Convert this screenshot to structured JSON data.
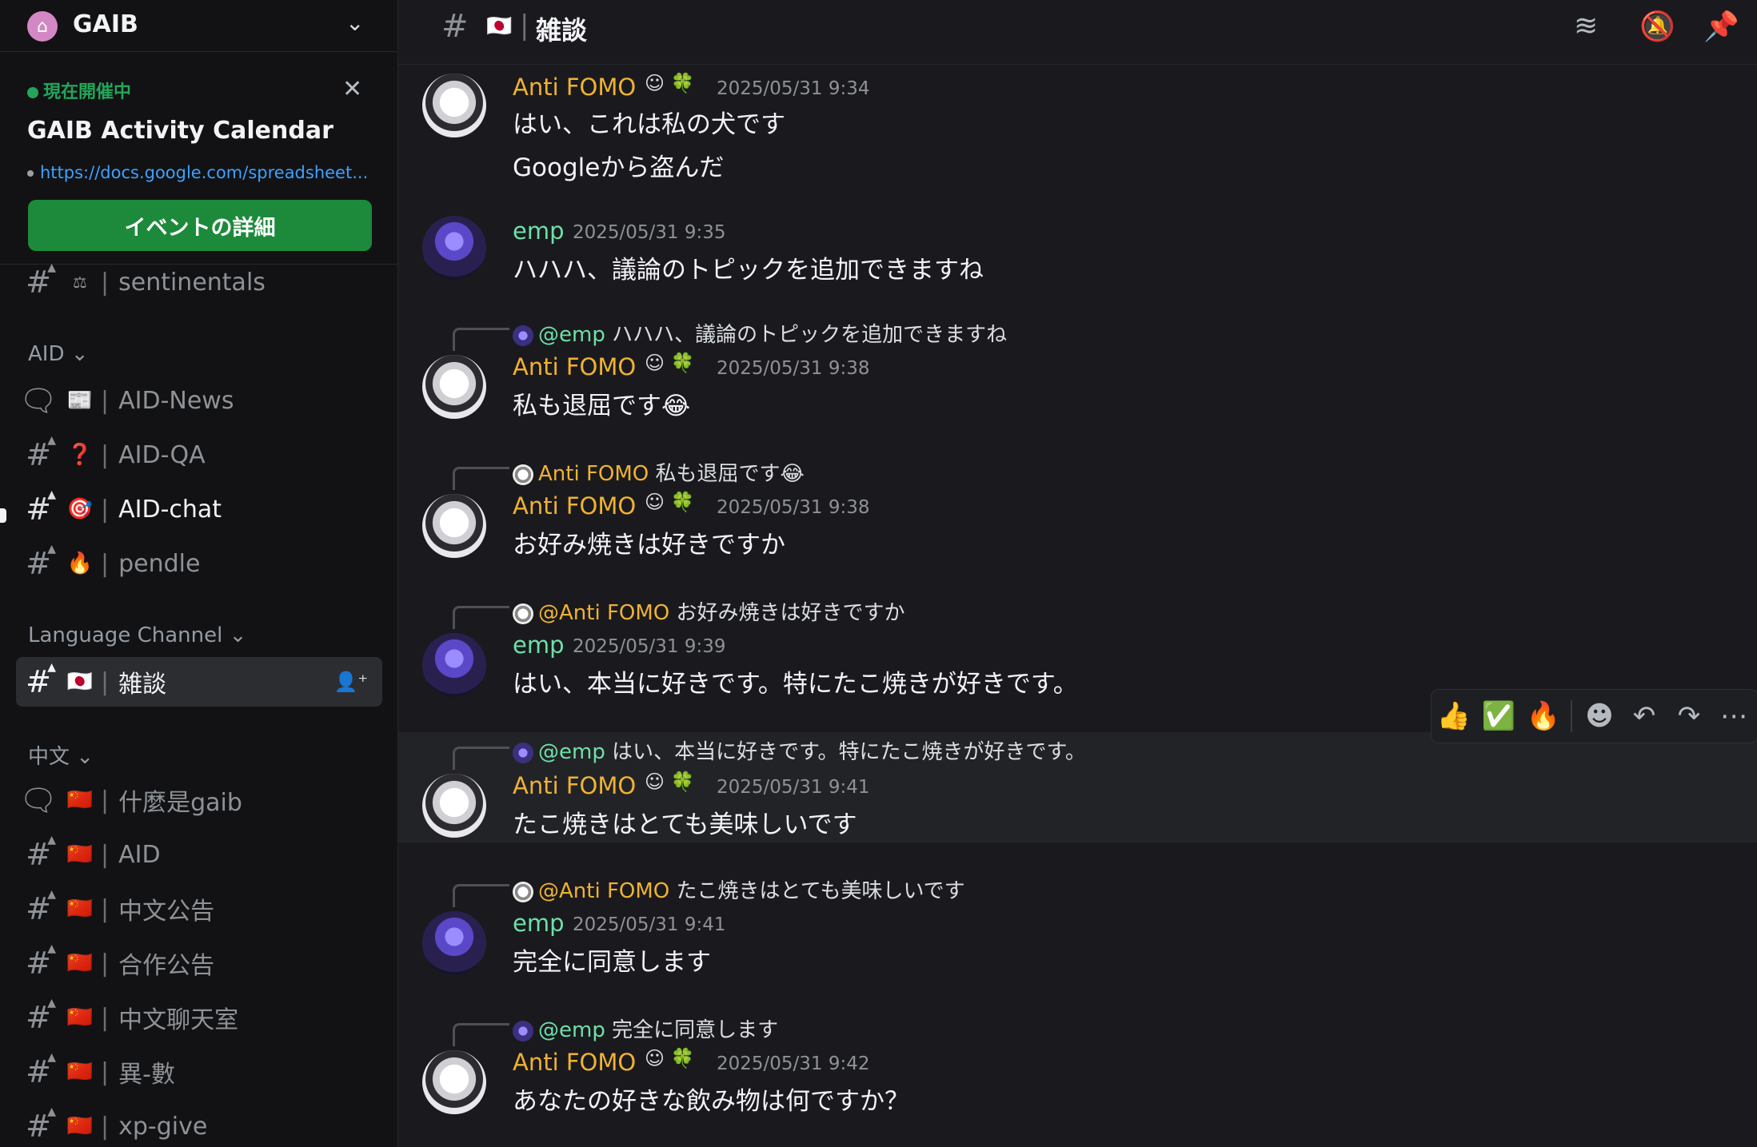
{
  "server": {
    "name": "GAIB",
    "icon": "home-icon"
  },
  "event": {
    "status": "現在開催中",
    "title": "GAIB Activity Calendar",
    "link": "https://docs.google.com/spreadsheet...",
    "button": "イベントの詳細"
  },
  "channels": {
    "top": {
      "emoji": "⚖",
      "name": "sentinentals"
    },
    "aid_category": "AID",
    "aid": [
      {
        "type": "forum",
        "emoji": "📰",
        "name": "AID-News"
      },
      {
        "type": "text",
        "emoji": "❓",
        "name": "AID-QA"
      },
      {
        "type": "text",
        "emoji": "🎯",
        "name": "AID-chat"
      },
      {
        "type": "text",
        "emoji": "🔥",
        "name": "pendle"
      }
    ],
    "lang_category": "Language Channel",
    "lang": [
      {
        "type": "text",
        "emoji": "🇯🇵",
        "name": "雑談"
      }
    ],
    "zh_category": "中文",
    "zh": [
      {
        "type": "forum",
        "emoji": "🇨🇳",
        "name": "什麼是gaib"
      },
      {
        "type": "text",
        "emoji": "🇨🇳",
        "name": "AID"
      },
      {
        "type": "text",
        "emoji": "🇨🇳",
        "name": "中文公告"
      },
      {
        "type": "text",
        "emoji": "🇨🇳",
        "name": "合作公告"
      },
      {
        "type": "text",
        "emoji": "🇨🇳",
        "name": "中文聊天室"
      },
      {
        "type": "text",
        "emoji": "🇨🇳",
        "name": "異-數"
      },
      {
        "type": "text",
        "emoji": "🇨🇳",
        "name": "xp-give"
      }
    ]
  },
  "header": {
    "flag": "🇯🇵",
    "sep": "|",
    "name": "雑談",
    "icons": [
      "threads-icon",
      "mute-icon",
      "pin-icon"
    ]
  },
  "messages": [
    {
      "author": "Anti FOMO",
      "time": "2025/05/31 9:34",
      "lines": [
        "はい、これは私の犬です",
        "Googleから盗んだ"
      ]
    },
    {
      "author": "emp",
      "time": "2025/05/31 9:35",
      "lines": [
        "ハハハ、議論のトピックを追加できますね"
      ]
    },
    {
      "reply_name": "@emp",
      "reply_text": "ハハハ、議論のトピックを追加できますね",
      "author": "Anti FOMO",
      "time": "2025/05/31 9:38",
      "lines": [
        "私も退屈です😂"
      ]
    },
    {
      "reply_name": "Anti FOMO",
      "reply_text": "私も退屈です😂",
      "author": "Anti FOMO",
      "time": "2025/05/31 9:38",
      "lines": [
        "お好み焼きは好きですか"
      ]
    },
    {
      "reply_name": "@Anti FOMO",
      "reply_text": "お好み焼きは好きですか",
      "author": "emp",
      "time": "2025/05/31 9:39",
      "lines": [
        "はい、本当に好きです。特にたこ焼きが好きです。"
      ]
    },
    {
      "reply_name": "@emp",
      "reply_text": "はい、本当に好きです。特にたこ焼きが好きです。",
      "author": "Anti FOMO",
      "time": "2025/05/31 9:41",
      "lines": [
        "たこ焼きはとても美味しいです"
      ]
    },
    {
      "reply_name": "@Anti FOMO",
      "reply_text": "たこ焼きはとても美味しいです",
      "author": "emp",
      "time": "2025/05/31 9:41",
      "lines": [
        "完全に同意します"
      ]
    },
    {
      "reply_name": "@emp",
      "reply_text": "完全に同意します",
      "author": "Anti FOMO",
      "time": "2025/05/31 9:42",
      "lines": [
        "あなたの好きな飲み物は何ですか？"
      ]
    }
  ],
  "badges": {
    "fomo": "☺ 🍀"
  },
  "toolbar": [
    "👍",
    "✅",
    "🔥",
    "smiley-icon",
    "reply-icon",
    "forward-icon",
    "more-icon"
  ]
}
